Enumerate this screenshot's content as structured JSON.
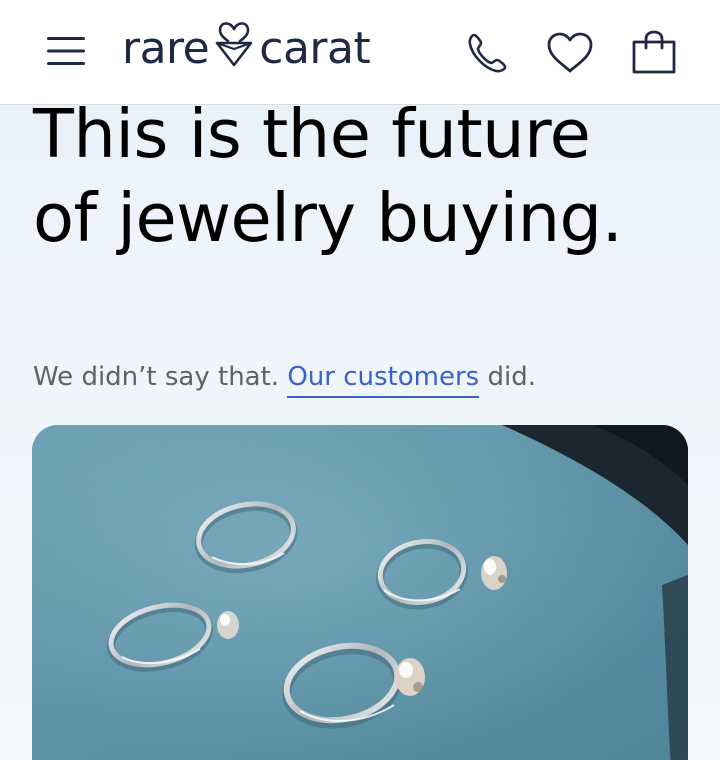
{
  "header": {
    "menu_icon": "hamburger-menu-icon",
    "logo": {
      "word1": "rare",
      "word2": "carat",
      "mark_icon": "heart-gem-icon"
    },
    "phone_icon": "phone-icon",
    "wishlist_icon": "heart-icon",
    "cart_icon": "shopping-bag-icon"
  },
  "hero": {
    "headline_line1": "This is the future",
    "headline_line2": "of jewelry buying.",
    "sub_prefix": "We didn’t say that. ",
    "sub_link": "Our customers",
    "sub_suffix": " did."
  },
  "colors": {
    "brand_navy": "#1e2a44",
    "link_blue": "#3a63c9",
    "hero_background": "#e6f0f8",
    "subtext_gray": "#5f6368"
  }
}
